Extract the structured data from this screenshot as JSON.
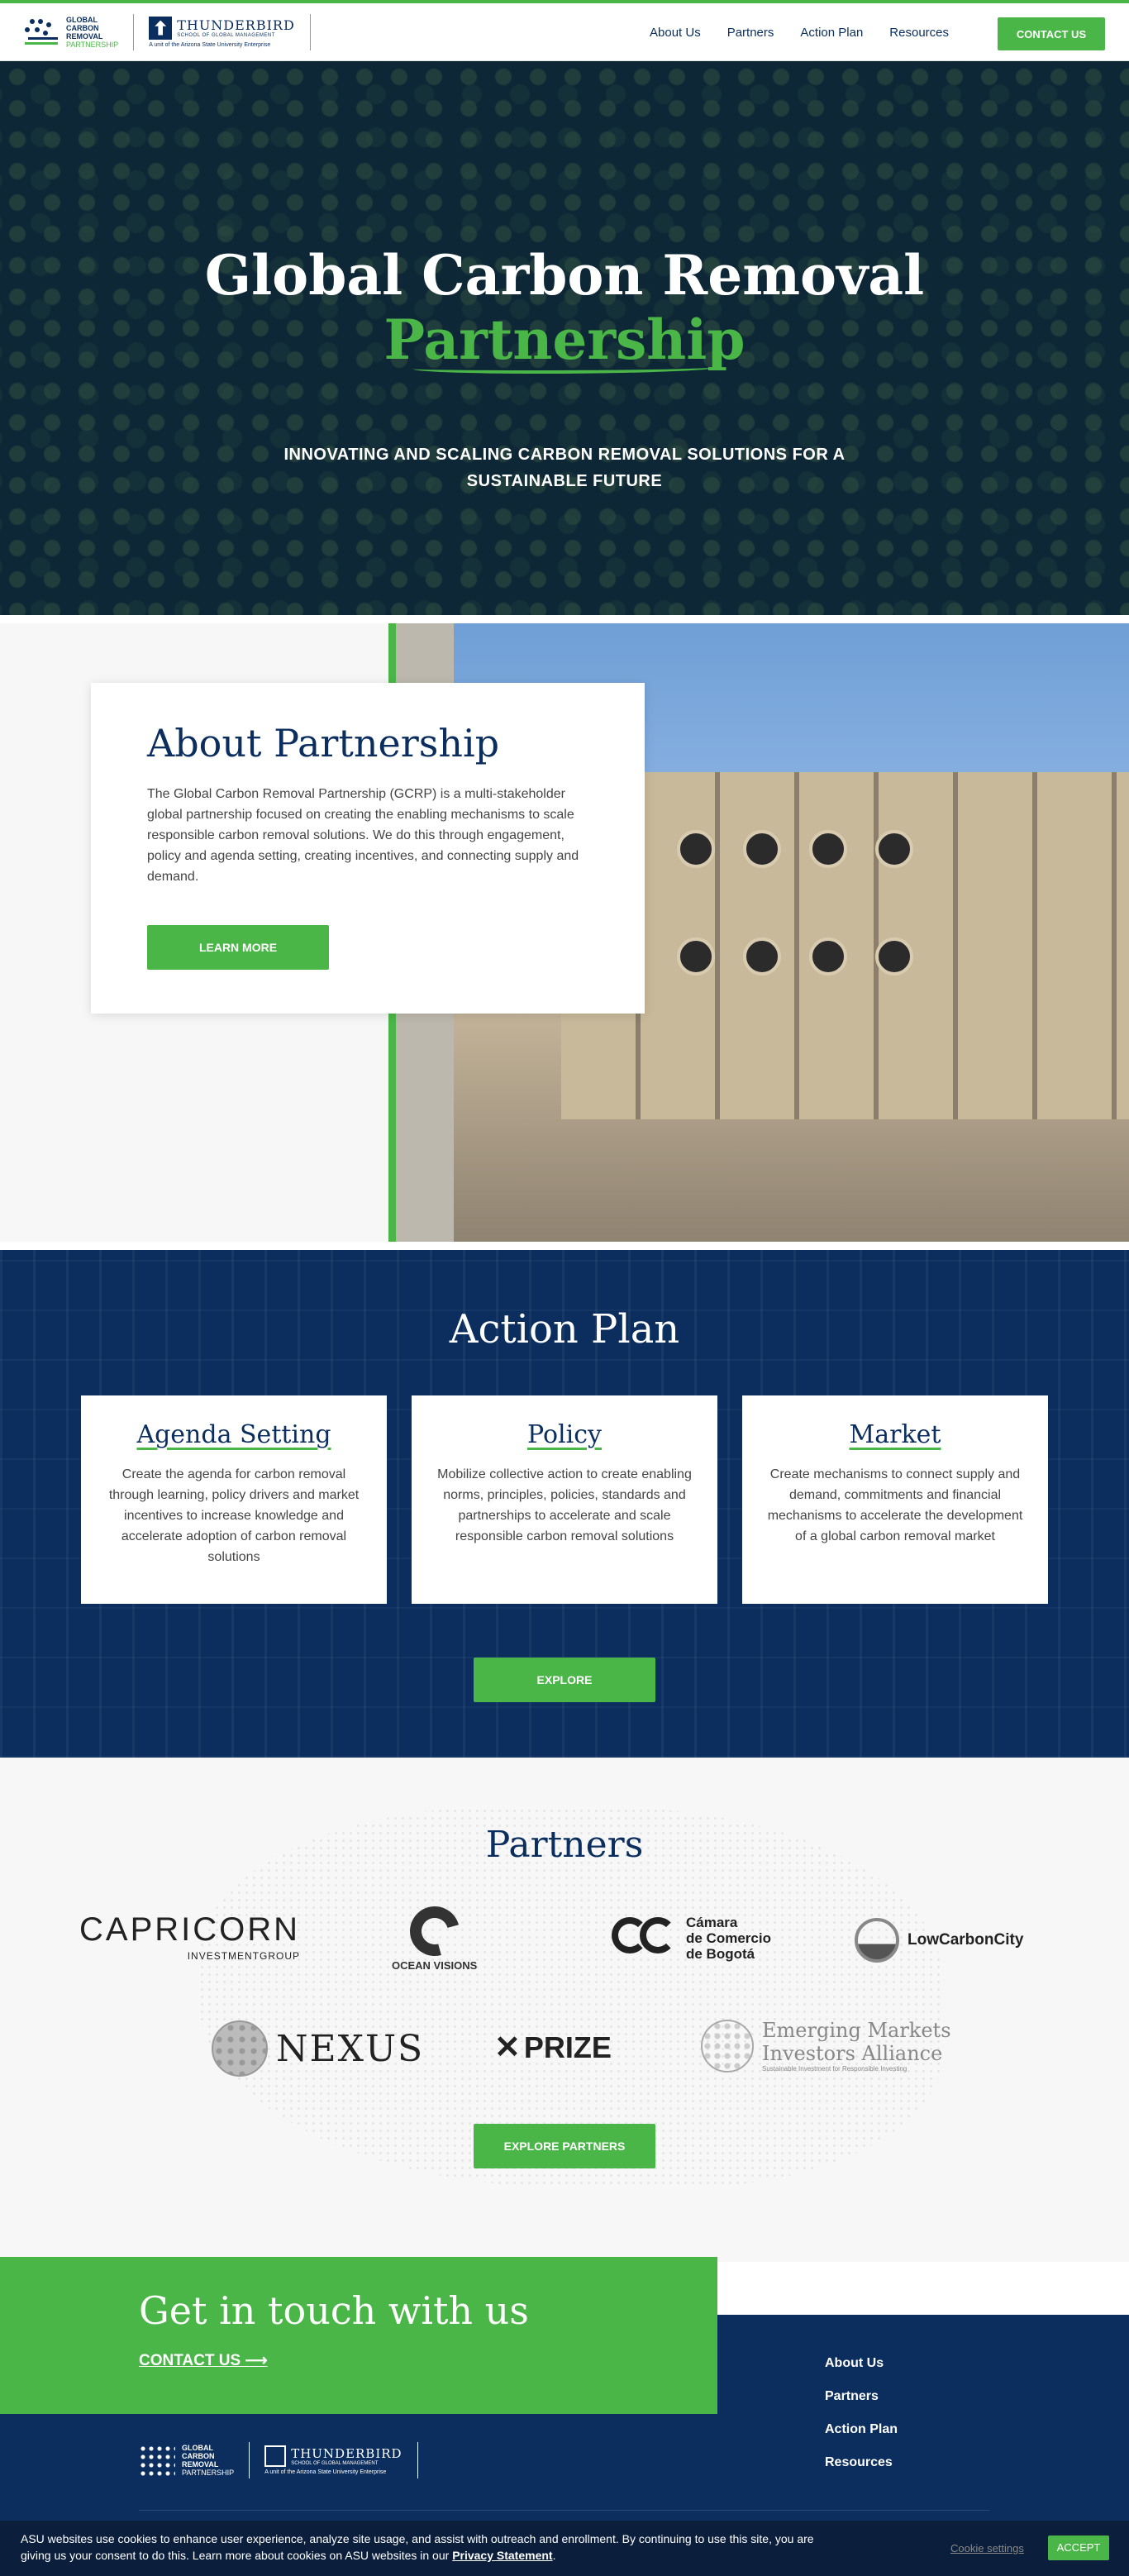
{
  "header": {
    "logo": {
      "line1": "GLOBAL",
      "line2": "CARBON",
      "line3": "REMOVAL",
      "line4": "PARTNERSHIP"
    },
    "tb": {
      "name": "THUNDERBIRD",
      "sub": "SCHOOL OF GLOBAL MANAGEMENT",
      "unit": "A unit of the Arizona State University Enterprise"
    },
    "nav": [
      "About Us",
      "Partners",
      "Action Plan",
      "Resources"
    ],
    "contact": "CONTACT US"
  },
  "hero": {
    "title_line1": "Global Carbon Removal",
    "title_line2": "Partnership",
    "subtitle": "INNOVATING AND SCALING CARBON REMOVAL SOLUTIONS FOR A SUSTAINABLE FUTURE"
  },
  "about": {
    "title": "About Partnership",
    "body": "The Global Carbon Removal Partnership (GCRP) is a multi-stakeholder global partnership focused on creating the enabling mechanisms to scale responsible carbon removal solutions. We do this through engagement, policy and agenda setting, creating incentives, and connecting supply and demand.",
    "button": "LEARN MORE"
  },
  "action": {
    "title": "Action Plan",
    "cards": [
      {
        "title": "Agenda Setting",
        "body": "Create the agenda for carbon removal through learning, policy drivers and market incentives to increase knowledge and accelerate adoption of carbon removal solutions"
      },
      {
        "title": "Policy",
        "body": "Mobilize collective action to create enabling norms, principles, policies, standards and partnerships to accelerate and scale responsible carbon removal solutions"
      },
      {
        "title": "Market",
        "body": "Create mechanisms to connect supply and demand, commitments and financial mechanisms to accelerate the development of a global carbon removal market"
      }
    ],
    "button": "EXPLORE"
  },
  "partners": {
    "title": "Partners",
    "capricorn": {
      "name": "CAPRICORN",
      "sub": "INVESTMENTGROUP"
    },
    "ocean": "OCEAN VISIONS",
    "camara": {
      "l1": "Cámara",
      "l2": "de Comercio",
      "l3": "de Bogotá"
    },
    "lowcarbon": "LowCarbonCity",
    "nexus": "NEXUS",
    "xprize": "PRIZE",
    "emia": {
      "l1": "Emerging Markets",
      "l2": "Investors Alliance",
      "sub": "Sustainable Investment for Responsible Investing"
    },
    "button": "EXPLORE PARTNERS"
  },
  "contact": {
    "title": "Get in touch with us",
    "link": "CONTACT US ⟶"
  },
  "footer": {
    "links": [
      "About Us",
      "Partners",
      "Action Plan",
      "Resources"
    ]
  },
  "cookie": {
    "text": "ASU websites use cookies to enhance user experience, analyze site usage, and assist with outreach and enrollment. By continuing to use this site, you are giving us your consent to do this. Learn more about cookies on ASU websites in our ",
    "link": "Privacy Statement",
    "settings": "Cookie settings",
    "accept": "ACCEPT"
  },
  "colors": {
    "brand_green": "#4bb648",
    "brand_navy": "#0b2e5e"
  }
}
